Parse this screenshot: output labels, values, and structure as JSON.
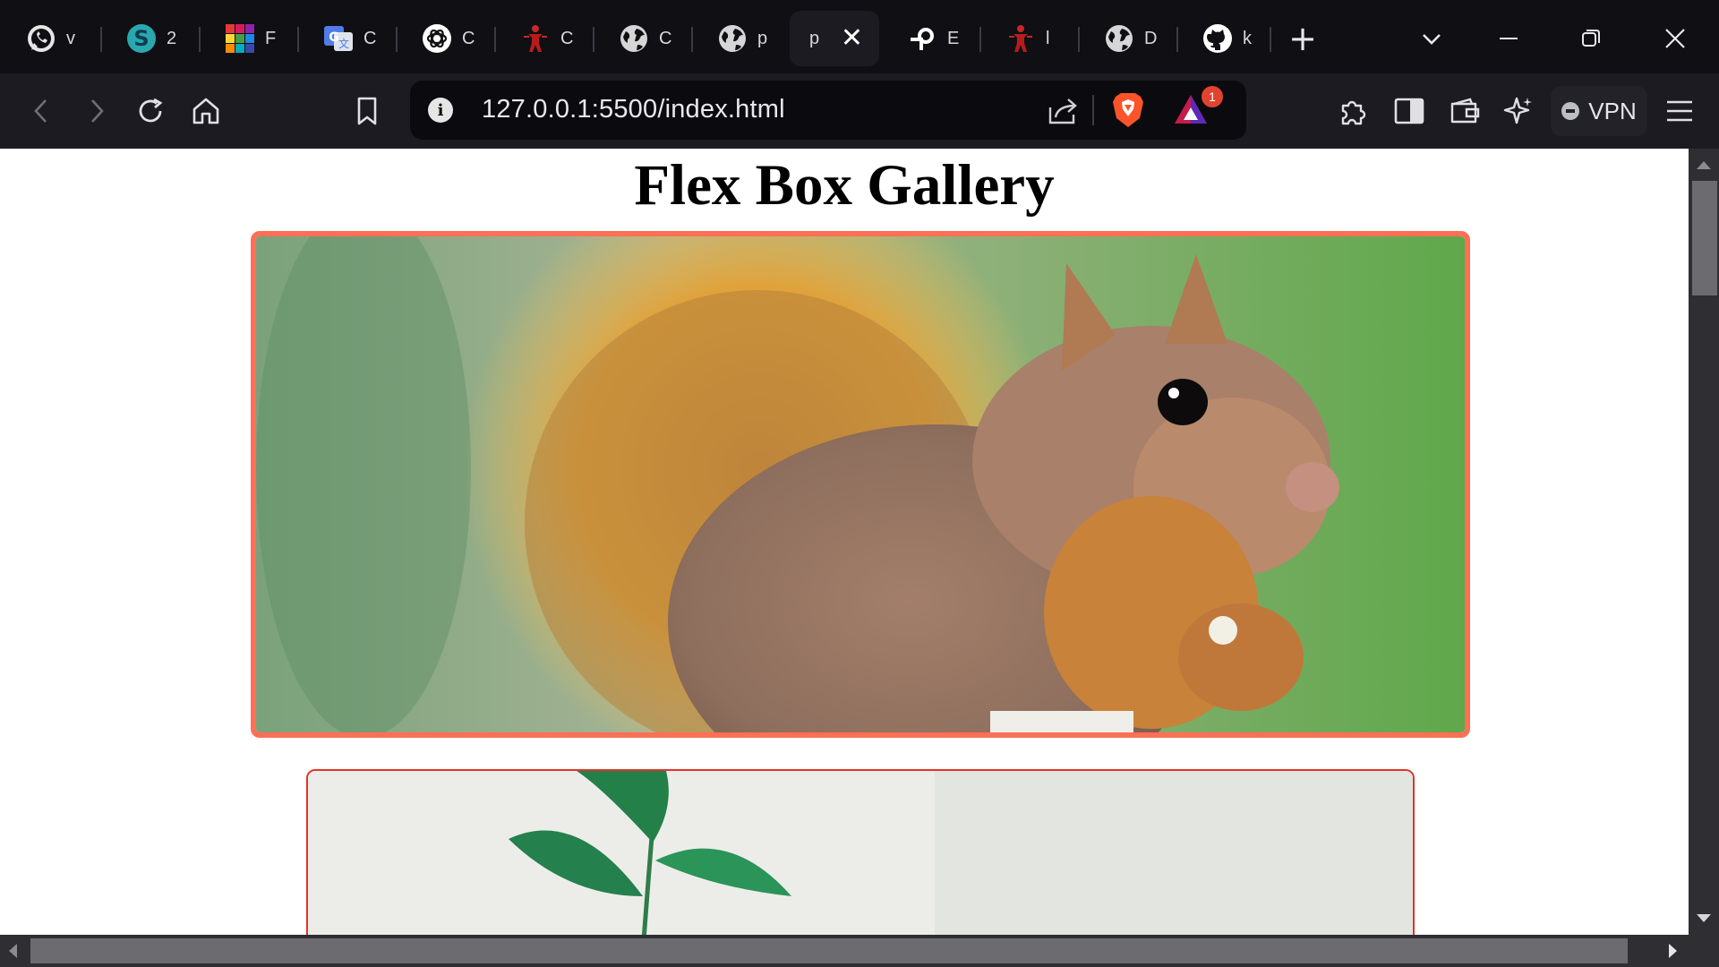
{
  "browser": {
    "tabs": [
      {
        "icon": "whatsapp-icon",
        "title": "v"
      },
      {
        "icon": "scratch-s-icon",
        "title": "2"
      },
      {
        "icon": "color-grid-icon",
        "title": "F"
      },
      {
        "icon": "google-translate-icon",
        "title": "C"
      },
      {
        "icon": "openai-icon",
        "title": "C"
      },
      {
        "icon": "red-figure-icon",
        "title": "C"
      },
      {
        "icon": "globe-icon",
        "title": "C"
      },
      {
        "icon": "globe-icon",
        "title": "p"
      },
      {
        "icon": "",
        "title": "p",
        "active": true
      },
      {
        "icon": "pointer-p-icon",
        "title": "E"
      },
      {
        "icon": "red-figure-icon",
        "title": "l"
      },
      {
        "icon": "globe-icon",
        "title": "D"
      },
      {
        "icon": "github-icon",
        "title": "k"
      }
    ],
    "new_tab_label": "+",
    "address": {
      "url": "127.0.0.1:5500/index.html",
      "info_glyph": "i",
      "rewards_badge": "1"
    },
    "vpn_label": "VPN"
  },
  "page": {
    "title": "Flex Box Gallery",
    "images": [
      {
        "subject": "red squirrel eating",
        "border_color": "#ff6f56"
      },
      {
        "subject": "green plant sprig on white wall",
        "border_color": "#e3342a"
      }
    ]
  }
}
